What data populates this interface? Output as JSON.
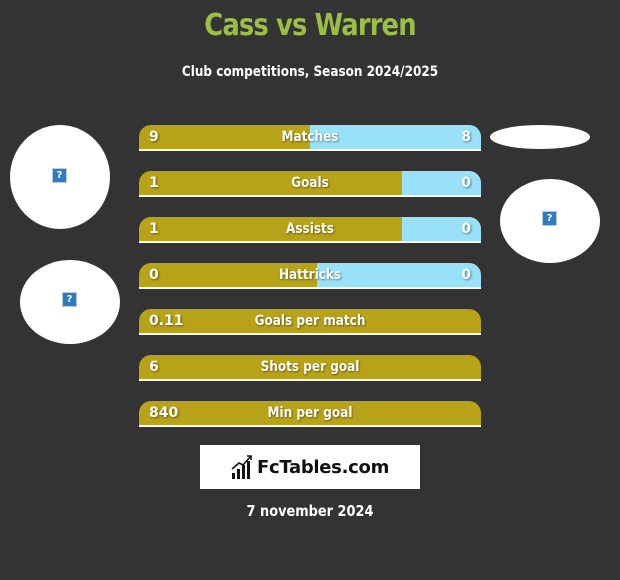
{
  "header": {
    "title": "Cass vs Warren",
    "subtitle": "Club competitions, Season 2024/2025"
  },
  "colors": {
    "background": "#333333",
    "title": "#9bbe44",
    "left_bar": "#b8a218",
    "right_bar": "#99e1f9"
  },
  "stats": [
    {
      "label": "Matches",
      "left": "9",
      "right": "8",
      "left_share": 0.5
    },
    {
      "label": "Goals",
      "left": "1",
      "right": "0",
      "left_share": 0.77
    },
    {
      "label": "Assists",
      "left": "1",
      "right": "0",
      "left_share": 0.77
    },
    {
      "label": "Hattricks",
      "left": "0",
      "right": "0",
      "left_share": 0.52
    },
    {
      "label": "Goals per match",
      "left": "0.11",
      "right": null,
      "left_share": 1
    },
    {
      "label": "Shots per goal",
      "left": "6",
      "right": null,
      "left_share": 1
    },
    {
      "label": "Min per goal",
      "left": "840",
      "right": null,
      "left_share": 1
    }
  ],
  "images": {
    "placeholder_glyph": "?",
    "icon": "broken-image-icon"
  },
  "logo": {
    "text": "FcTables.com",
    "icon": "bar-chart-icon"
  },
  "footer": {
    "date": "7 november 2024"
  }
}
